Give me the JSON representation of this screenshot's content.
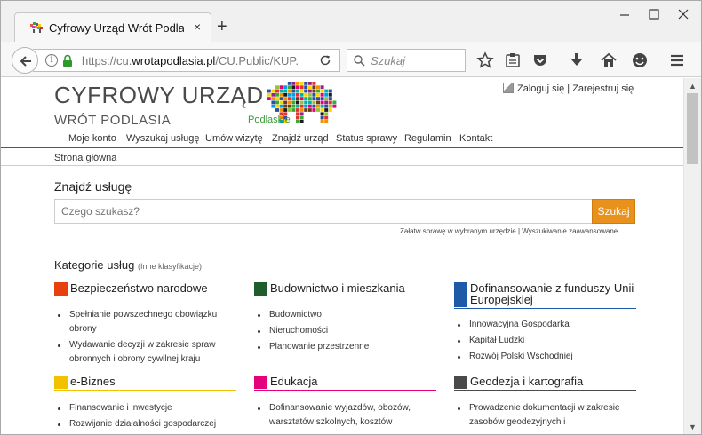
{
  "browser": {
    "tab_title": "Cyfrowy Urząd Wrót Podlasia",
    "tab_close": "×",
    "new_tab": "+",
    "url_prefix": "https://cu.",
    "url_host": "wrotapodlasia.pl",
    "url_path": "/CU.Public/KUP.",
    "search_placeholder": "Szukaj"
  },
  "header": {
    "title": "CYFROWY URZĄD",
    "subtitle": "WRÓT PODLASIA",
    "logo_text": "Podlaskie",
    "login": "Zaloguj się",
    "separator": "|",
    "register": "Zarejestruj się"
  },
  "nav": [
    "Moje konto",
    "Wyszukaj usługę",
    "Umów wizytę",
    "Znajdź urząd",
    "Status sprawy",
    "Regulamin",
    "Kontakt"
  ],
  "breadcrumb": "Strona główna",
  "search": {
    "heading": "Znajdź usługę",
    "placeholder": "Czego szukasz?",
    "button": "Szukaj",
    "link1": "Załatw sprawę w wybranym urzędzie",
    "link_sep": "|",
    "link2": "Wyszukiwanie zaawansowane"
  },
  "categories_heading": "Kategorie usług",
  "categories_sub": "(Inne klasyfikacje)",
  "categories": [
    {
      "title": "Bezpieczeństwo narodowe",
      "color": "#e8400c",
      "items": [
        "Spełnianie powszechnego obowiązku obrony",
        "Wydawanie decyzji w zakresie spraw obronnych i obrony cywilnej kraju"
      ]
    },
    {
      "title": "Budownictwo i mieszkania",
      "color": "#1f5e2c",
      "items": [
        "Budownictwo",
        "Nieruchomości",
        "Planowanie przestrzenne"
      ]
    },
    {
      "title": "Dofinansowanie z funduszy Unii Europejskiej",
      "color": "#1e5aa8",
      "items": [
        "Innowacyjna Gospodarka",
        "Kapitał Ludzki",
        "Rozwój Polski Wschodniej"
      ]
    },
    {
      "title": "e-Biznes",
      "color": "#f2c100",
      "items": [
        "Finansowanie i inwestycje",
        "Rozwijanie działalności gospodarczej"
      ]
    },
    {
      "title": "Edukacja",
      "color": "#e5007e",
      "items": [
        "Dofinansowanie wyjazdów, obozów, warsztatów szkolnych, kosztów"
      ]
    },
    {
      "title": "Geodezja i kartografia",
      "color": "#4a4a4a",
      "items": [
        "Prowadzenie dokumentacji w zakresie zasobów geodezyjnych i"
      ]
    }
  ]
}
